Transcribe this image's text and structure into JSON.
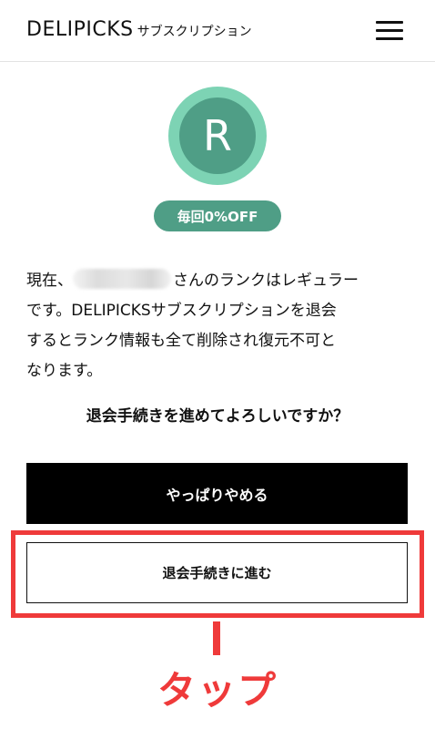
{
  "header": {
    "logo_main": "DELIPICKS",
    "logo_sub": "サブスクリプション",
    "menu_icon": "hamburger-menu-icon"
  },
  "rank": {
    "letter": "R",
    "badge": "毎回0%OFF",
    "colors": {
      "outer_ring": "#7dd3b4",
      "inner": "#4f9e86",
      "badge": "#4f9e86"
    }
  },
  "message": {
    "line1_prefix": "現在、",
    "line1_suffix": "さんのランクはレギュラー",
    "line2": "です。DELIPICKSサブスクリプションを退会",
    "line3": "するとランク情報も全て削除され復元不可と",
    "line4": "なります。"
  },
  "question": "退会手続きを進めてよろしいですか？",
  "buttons": {
    "cancel_label": "やっぱりやめる",
    "proceed_label": "退会手続きに進む"
  },
  "annotation": {
    "tap_label": "タップ",
    "color": "#ef3a3a"
  }
}
